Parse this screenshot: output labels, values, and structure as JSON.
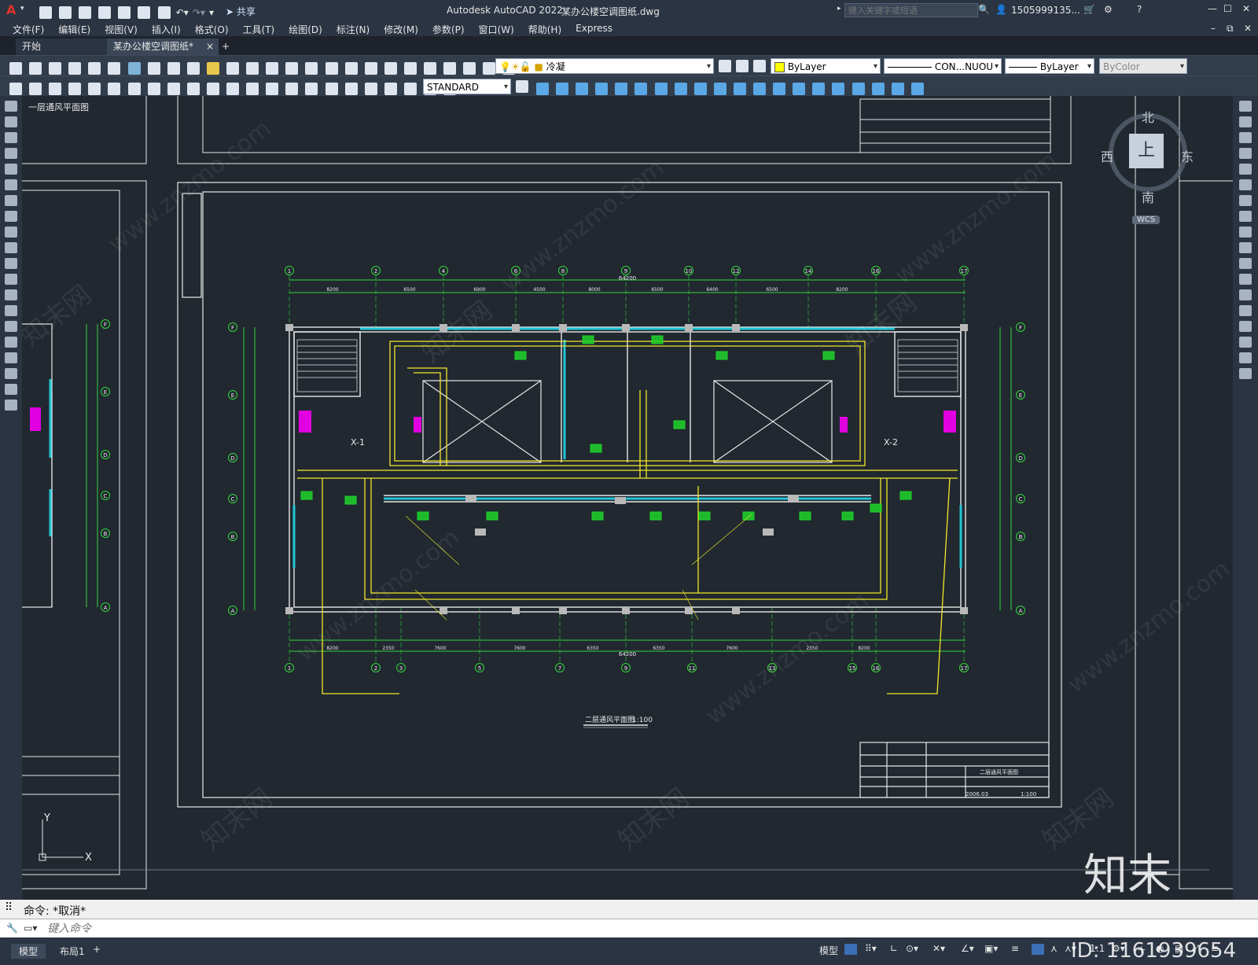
{
  "app": {
    "title": "Autodesk AutoCAD 2022",
    "file": "某办公楼空调图纸.dwg",
    "search_placeholder": "键入关键字或短语",
    "user": "1505999135...",
    "logo_letter": "A"
  },
  "quick_access": {
    "share_label": "共享"
  },
  "menu": [
    "文件(F)",
    "编辑(E)",
    "视图(V)",
    "插入(I)",
    "格式(O)",
    "工具(T)",
    "绘图(D)",
    "标注(N)",
    "修改(M)",
    "参数(P)",
    "窗口(W)",
    "帮助(H)",
    "Express"
  ],
  "tabs": {
    "start": "开始",
    "active": "某办公楼空调图纸*",
    "close": "×",
    "add": "+"
  },
  "toolbar1": {
    "layer_value": "冷凝",
    "color_value": "ByLayer",
    "linetype_value": "CON...NUOU",
    "lineweight_value": "ByLayer",
    "plotstyle_value": "ByColor"
  },
  "toolbar2": {
    "textstyle_value": "STANDARD"
  },
  "viewcube": {
    "north": "北",
    "south": "南",
    "west": "西",
    "east": "东",
    "face": "上",
    "wcs": "WCS"
  },
  "drawing": {
    "plan_title": "二层通风平面图",
    "plan_scale": "1:100",
    "left_partial_title": "一层通风平面图",
    "axis_numbers": [
      "1",
      "2",
      "4",
      "6",
      "8",
      "9",
      "10",
      "12",
      "14",
      "16",
      "17"
    ],
    "axis_numbers_bottom": [
      "1",
      "2",
      "3",
      "5",
      "7",
      "9",
      "11",
      "13",
      "15",
      "16",
      "17"
    ],
    "axis_letters": [
      "F",
      "E",
      "D",
      "C",
      "B",
      "A"
    ],
    "total_dim": "64200",
    "top_dims": [
      "8200",
      "6500",
      "6900",
      "4500",
      "8000",
      "6500",
      "6400",
      "6500",
      "8200"
    ],
    "bottom_dims": [
      "8200",
      "2350",
      "7600",
      "7600",
      "6350",
      "6350",
      "7600",
      "2350",
      "8200"
    ],
    "labels": [
      "X-1",
      "X-2"
    ],
    "title_block_title": "二层通风平面图",
    "title_block_year": "2006.03",
    "title_block_scale": "1:100",
    "ucs_x": "X",
    "ucs_y": "Y"
  },
  "command": {
    "history": "命令: *取消*",
    "placeholder": "键入命令"
  },
  "status": {
    "model": "模型",
    "layout": "布局1",
    "add": "+",
    "model_right": "模型",
    "scale": "1:1"
  },
  "watermark": {
    "text": "www.znzmo.com",
    "brand": "知末",
    "brand_cn": "知末网",
    "id": "ID: 1161939654"
  }
}
